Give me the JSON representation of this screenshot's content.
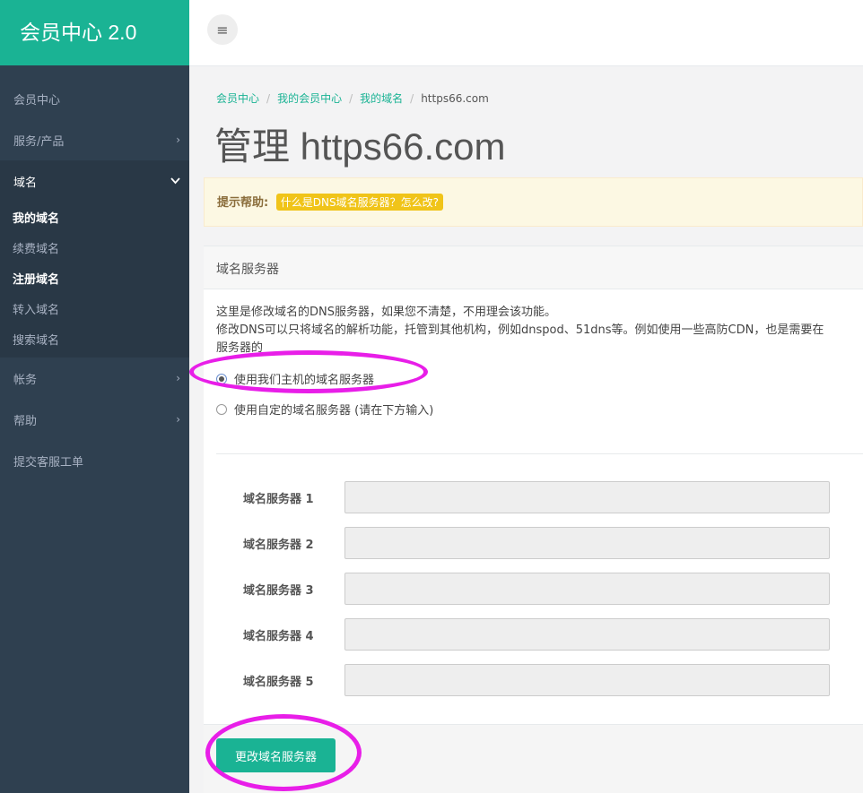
{
  "brand": "会员中心 2.0",
  "sidebar": {
    "items": [
      {
        "label": "会员中心"
      },
      {
        "label": "服务/产品"
      },
      {
        "label": "域名"
      },
      {
        "label": "帐务"
      },
      {
        "label": "帮助"
      },
      {
        "label": "提交客服工单"
      }
    ],
    "sub_items": [
      {
        "label": "我的域名"
      },
      {
        "label": "续费域名"
      },
      {
        "label": "注册域名"
      },
      {
        "label": "转入域名"
      },
      {
        "label": "搜索域名"
      }
    ]
  },
  "breadcrumb": [
    "会员中心",
    "我的会员中心",
    "我的域名",
    "https66.com"
  ],
  "page_title": "管理 https66.com",
  "alert": {
    "label": "提示帮助:",
    "badge": "什么是DNS域名服务器？怎么改?"
  },
  "panel": {
    "title": "域名服务器",
    "desc_line1": "这里是修改域名的DNS服务器，如果您不清楚，不用理会该功能。",
    "desc_line2": "修改DNS可以只将域名的解析功能，托管到其他机构，例如dnspod、51dns等。例如使用一些高防CDN，也是需要在",
    "desc_line3": "服务器的",
    "option_default": "使用我们主机的域名服务器",
    "option_custom": "使用自定的域名服务器 (请在下方输入)",
    "ns_labels": [
      "域名服务器 1",
      "域名服务器 2",
      "域名服务器 3",
      "域名服务器 4",
      "域名服务器 5"
    ],
    "submit": "更改域名服务器"
  },
  "colors": {
    "accent": "#1ab394",
    "sidebar": "#2f4050",
    "highlight": "#e81ee8"
  }
}
